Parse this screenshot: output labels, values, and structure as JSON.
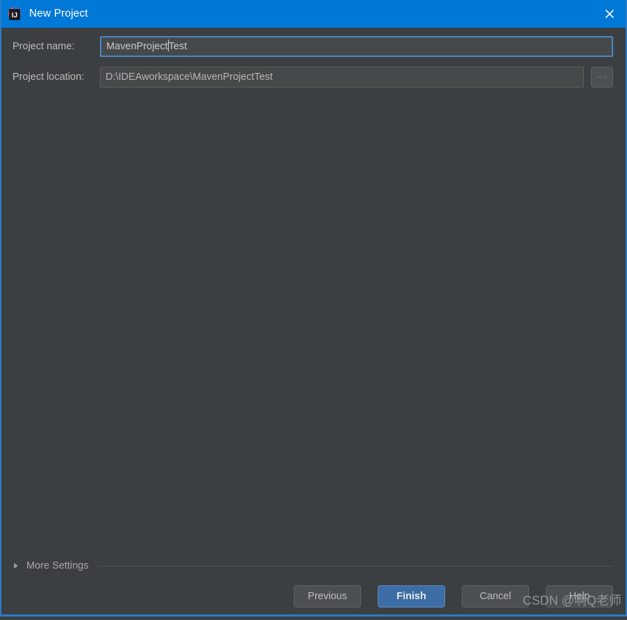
{
  "window": {
    "title": "New Project",
    "app_icon": "intellij-idea-icon",
    "close_icon": "close-icon",
    "titlebar_color": "#0078d7",
    "body_color": "#3c3f41",
    "border_color": "#2a7bc8"
  },
  "form": {
    "project_name": {
      "label": "Project name:",
      "value_before_caret": "MavenProject",
      "value_after_caret": "Test",
      "value": "MavenProjectTest",
      "placeholder": "Project name",
      "focused": true
    },
    "project_location": {
      "label": "Project location:",
      "value": "D:\\IDEAworkspace\\MavenProjectTest",
      "placeholder": "Project location",
      "browse_label": "...",
      "browse_icon": "ellipsis-icon"
    }
  },
  "more_settings": {
    "label": "More Settings",
    "expanded": false,
    "disclosure_icon": "chevron-right-icon"
  },
  "buttons": {
    "previous": "Previous",
    "finish": "Finish",
    "cancel": "Cancel",
    "help": "Help",
    "primary_color": "#3c6ea5"
  },
  "watermark": {
    "text": "CSDN @啊Q老师"
  }
}
